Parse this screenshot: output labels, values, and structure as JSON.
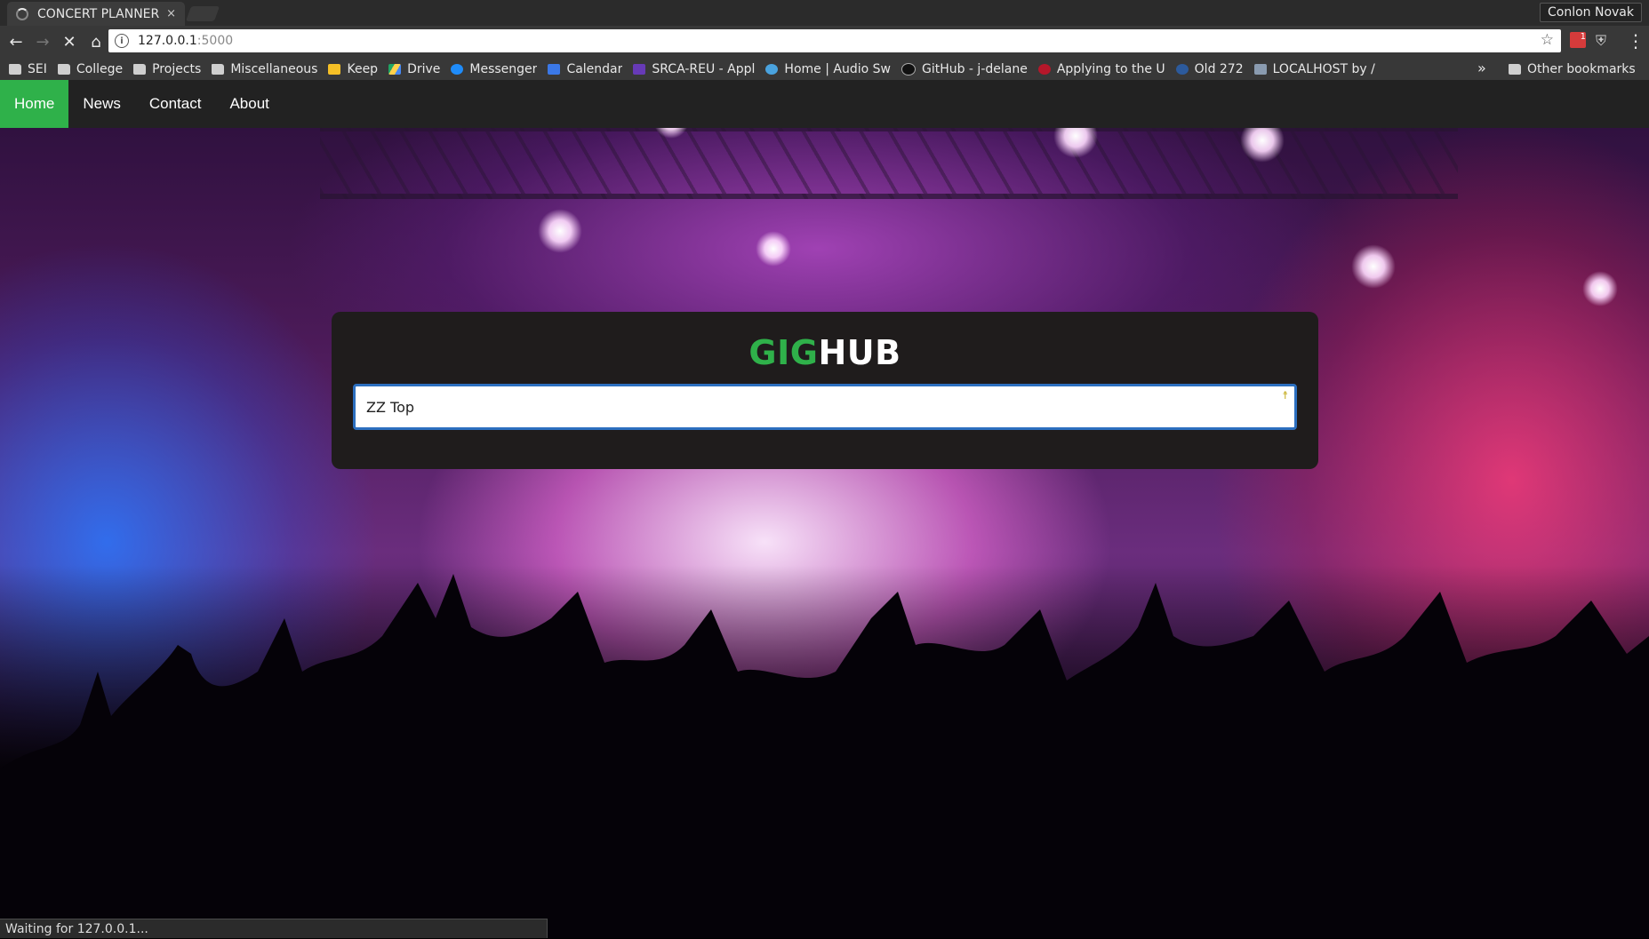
{
  "browser": {
    "tab_title": "CONCERT PLANNER",
    "tab_close": "×",
    "profile_name": "Conlon Novak",
    "url_host": "127.0.0.1",
    "url_port": ":5000",
    "status_text": "Waiting for 127.0.0.1...",
    "ext_badge": "1",
    "bookmarks": [
      {
        "label": "SEI",
        "icon": "folder-icon"
      },
      {
        "label": "College",
        "icon": "folder-icon"
      },
      {
        "label": "Projects",
        "icon": "folder-icon"
      },
      {
        "label": "Miscellaneous",
        "icon": "folder-icon"
      },
      {
        "label": "Keep",
        "icon": "keep-icon"
      },
      {
        "label": "Drive",
        "icon": "drive-icon"
      },
      {
        "label": "Messenger",
        "icon": "messenger-icon"
      },
      {
        "label": "Calendar",
        "icon": "calendar-icon"
      },
      {
        "label": "SRCA-REU - Appl",
        "icon": "form-icon"
      },
      {
        "label": "Home | Audio Sw",
        "icon": "audio-icon"
      },
      {
        "label": "GitHub - j-delane",
        "icon": "github-icon"
      },
      {
        "label": "Applying to the U",
        "icon": "site-icon"
      },
      {
        "label": "Old 272",
        "icon": "site-icon"
      },
      {
        "label": "LOCALHOST by /",
        "icon": "page-icon"
      }
    ],
    "overflow_label": "»",
    "other_bookmarks": "Other bookmarks"
  },
  "nav": {
    "items": [
      "Home",
      "News",
      "Contact",
      "About"
    ],
    "active": "Home"
  },
  "hero": {
    "brand_part1": "GIG",
    "brand_part2": "HUB",
    "search_value": "ZZ Top"
  },
  "colors": {
    "accent_green": "#2fb14a",
    "nav_bg": "#222222",
    "panel_bg": "#1f1c1c",
    "input_border": "#2c6fbf"
  }
}
